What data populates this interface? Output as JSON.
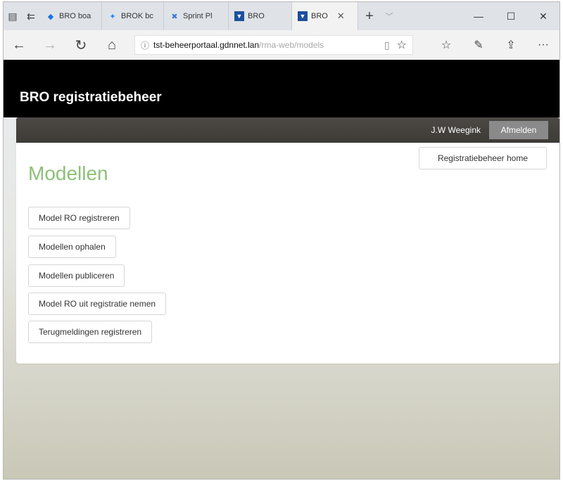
{
  "browser": {
    "tabs": [
      {
        "label": "BRO boa",
        "favicon": "blue-diamond-icon",
        "color": "#1a73e8"
      },
      {
        "label": "BROK bc",
        "favicon": "jira-icon",
        "color": "#2684ff"
      },
      {
        "label": "Sprint Pl",
        "favicon": "x-app-icon",
        "color": "#3d7bd9"
      },
      {
        "label": "BRO",
        "favicon": "bro-site-icon",
        "color": "#1d4f9c"
      },
      {
        "label": "BRO",
        "favicon": "bro-site-icon",
        "color": "#1d4f9c",
        "active": true
      }
    ],
    "close_glyph": "✕",
    "new_tab_glyph": "+",
    "address": {
      "host": "tst-beheerportaal.gdnnet.lan",
      "path": "/rma-web/models"
    }
  },
  "site": {
    "title": "BRO registratiebeheer",
    "user": "J.W Weegink",
    "logout_label": "Afmelden",
    "home_label": "Registratiebeheer home"
  },
  "main": {
    "heading": "Modellen",
    "actions": [
      "Model RO registreren",
      "Modellen ophalen",
      "Modellen publiceren",
      "Model RO uit registratie nemen",
      "Terugmeldingen registreren"
    ]
  },
  "colors": {
    "header_bg": "#000000",
    "heading_green": "#8cc079",
    "userbar_bg": "#45423e",
    "logout_bg": "#8a8a8a"
  }
}
